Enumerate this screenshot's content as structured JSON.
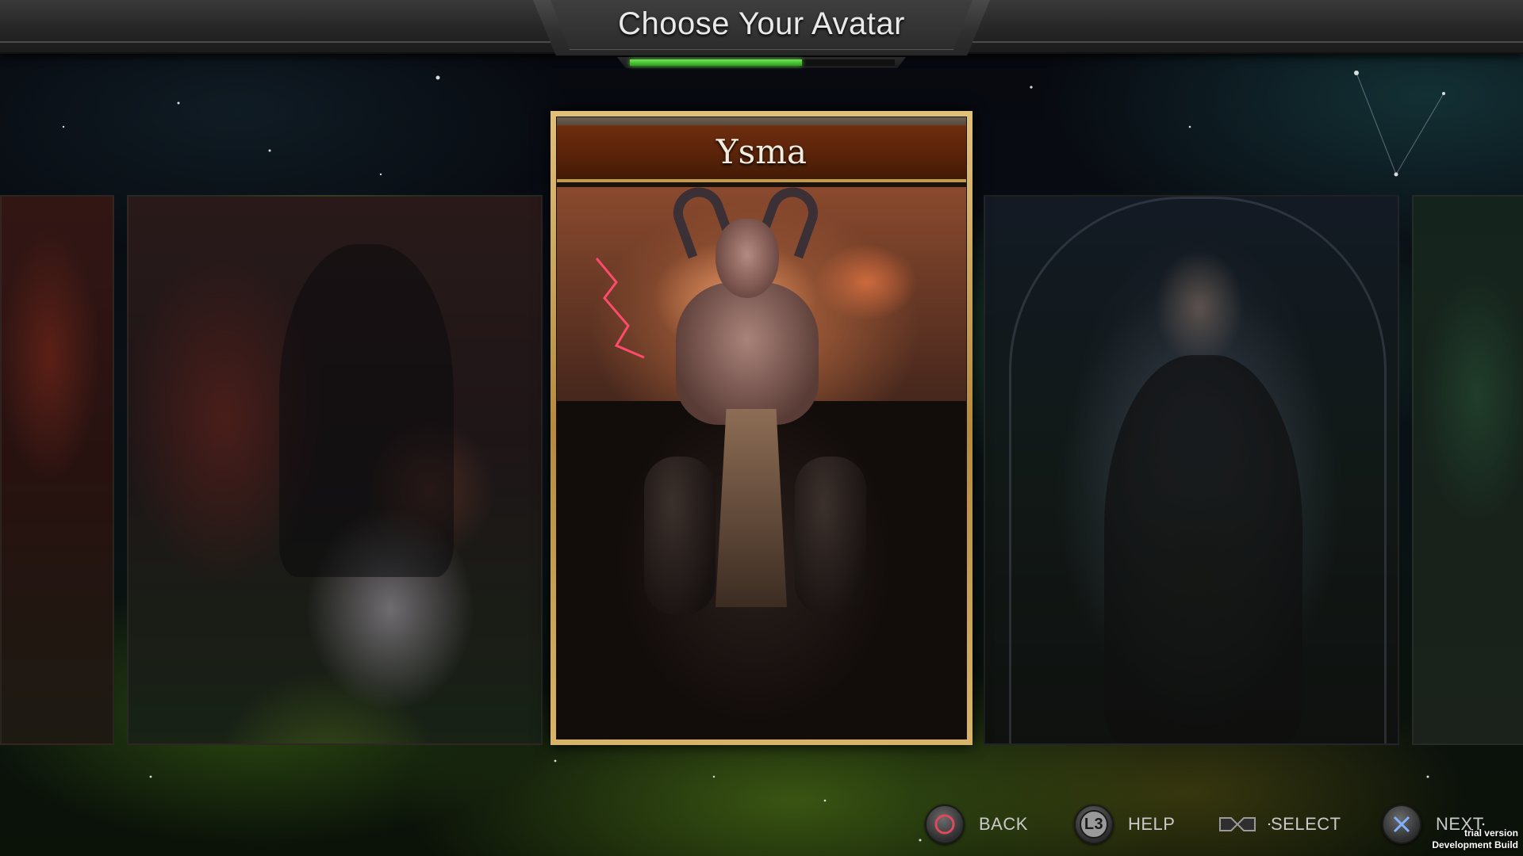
{
  "header": {
    "title": "Choose Your Avatar",
    "progress": 0.65
  },
  "carousel": {
    "selected": {
      "name": "Ysma"
    }
  },
  "controls": {
    "back": {
      "label": "BACK",
      "icon": "circle-button-icon"
    },
    "help": {
      "label": "HELP",
      "icon": "l3-button-icon",
      "glyph": "L3"
    },
    "select": {
      "label": "SELECT",
      "icon": "dpad-left-right-icon"
    },
    "next": {
      "label": "NEXT",
      "icon": "cross-button-icon"
    }
  },
  "build_info": {
    "line1": "trial version",
    "line2": "Development Build"
  },
  "colors": {
    "progress_green": "#4fd13a",
    "card_gold": "#c19a52",
    "circle_button": "#e0485e",
    "cross_button": "#7fb2ff"
  }
}
